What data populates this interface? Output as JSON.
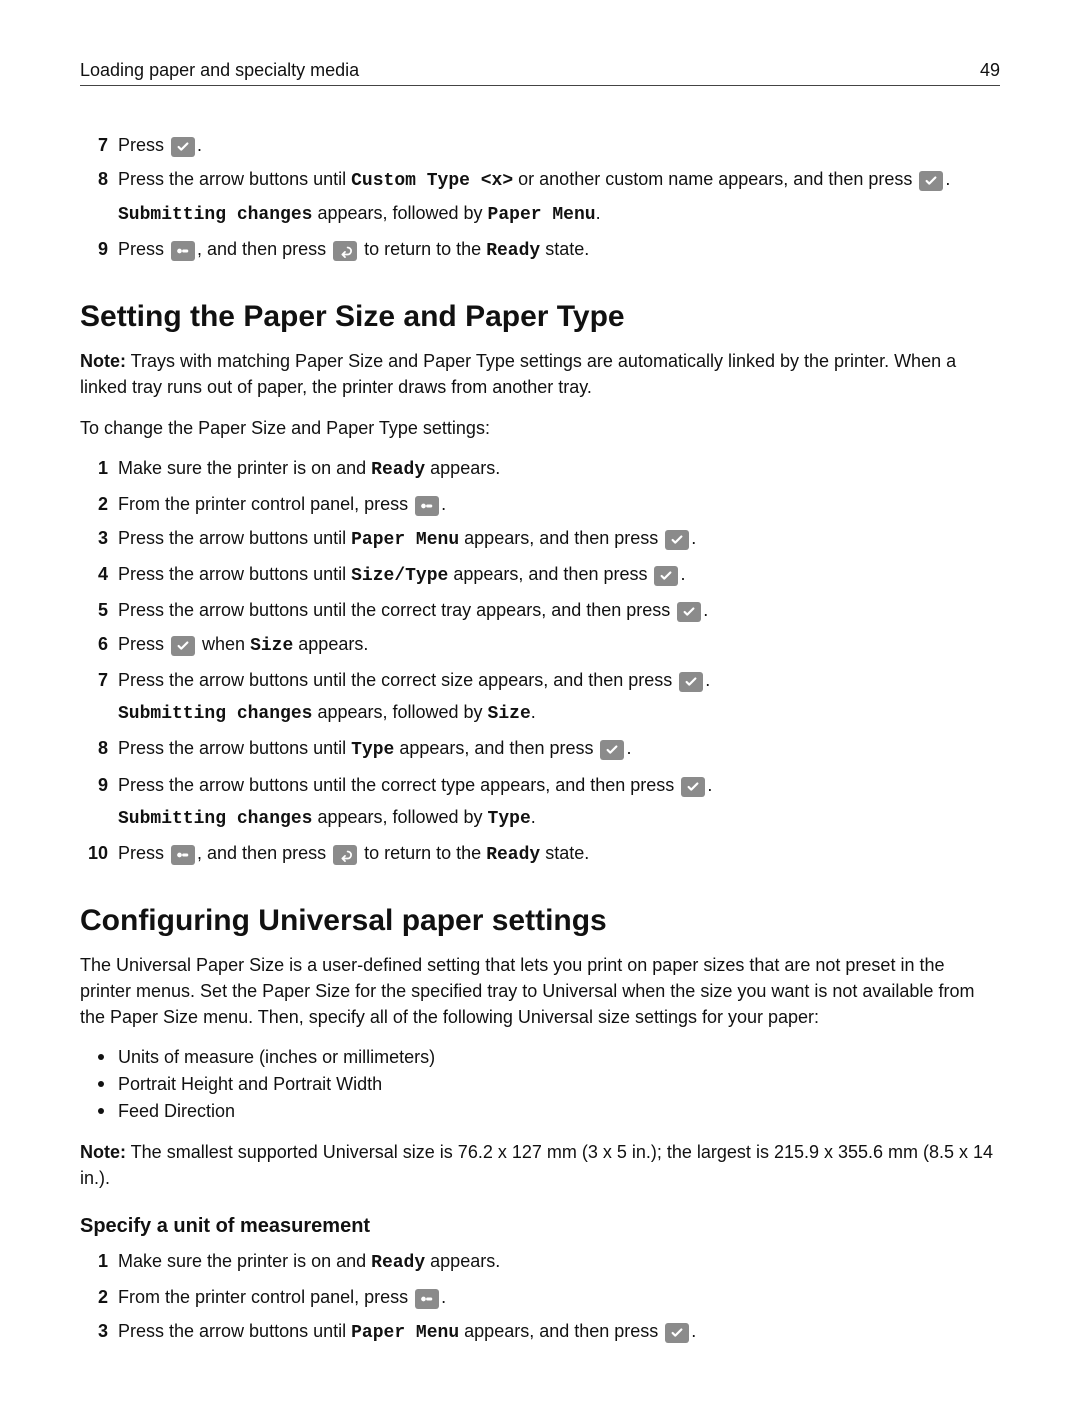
{
  "header": {
    "title": "Loading paper and specialty media",
    "page_number": "49"
  },
  "top_steps": [
    {
      "n": "7",
      "parts": [
        {
          "t": "Press "
        },
        {
          "icon": "check"
        },
        {
          "t": "."
        }
      ]
    },
    {
      "n": "8",
      "parts": [
        {
          "t": "Press the arrow buttons until "
        },
        {
          "mono": "Custom Type <x>"
        },
        {
          "t": " or another custom name appears, and then press "
        },
        {
          "icon": "check"
        },
        {
          "t": "."
        }
      ],
      "sub": [
        {
          "mono": "Submitting changes"
        },
        {
          "t": " appears, followed by "
        },
        {
          "mono": "Paper Menu"
        },
        {
          "t": "."
        }
      ]
    },
    {
      "n": "9",
      "parts": [
        {
          "t": "Press "
        },
        {
          "icon": "menu"
        },
        {
          "t": ", and then press "
        },
        {
          "icon": "back"
        },
        {
          "t": " to return to the "
        },
        {
          "mono": "Ready"
        },
        {
          "t": " state."
        }
      ]
    }
  ],
  "section1": {
    "heading": "Setting the Paper Size and Paper Type",
    "note_label": "Note:",
    "note": " Trays with matching Paper Size and Paper Type settings are automatically linked by the printer. When a linked tray runs out of paper, the printer draws from another tray.",
    "lead": "To change the Paper Size and Paper Type settings:",
    "steps": [
      {
        "n": "1",
        "parts": [
          {
            "t": "Make sure the printer is on and "
          },
          {
            "mono": "Ready"
          },
          {
            "t": " appears."
          }
        ]
      },
      {
        "n": "2",
        "parts": [
          {
            "t": "From the printer control panel, press "
          },
          {
            "icon": "menu"
          },
          {
            "t": "."
          }
        ]
      },
      {
        "n": "3",
        "parts": [
          {
            "t": "Press the arrow buttons until "
          },
          {
            "mono": "Paper Menu"
          },
          {
            "t": " appears, and then press "
          },
          {
            "icon": "check"
          },
          {
            "t": "."
          }
        ]
      },
      {
        "n": "4",
        "parts": [
          {
            "t": "Press the arrow buttons until "
          },
          {
            "mono": "Size/Type"
          },
          {
            "t": " appears, and then press "
          },
          {
            "icon": "check"
          },
          {
            "t": "."
          }
        ]
      },
      {
        "n": "5",
        "parts": [
          {
            "t": "Press the arrow buttons until the correct tray appears, and then press "
          },
          {
            "icon": "check"
          },
          {
            "t": "."
          }
        ]
      },
      {
        "n": "6",
        "parts": [
          {
            "t": "Press "
          },
          {
            "icon": "check"
          },
          {
            "t": " when "
          },
          {
            "mono": "Size"
          },
          {
            "t": " appears."
          }
        ]
      },
      {
        "n": "7",
        "parts": [
          {
            "t": "Press the arrow buttons until the correct size appears, and then press "
          },
          {
            "icon": "check"
          },
          {
            "t": "."
          }
        ],
        "sub": [
          {
            "mono": "Submitting changes"
          },
          {
            "t": " appears, followed by "
          },
          {
            "mono": "Size"
          },
          {
            "t": "."
          }
        ]
      },
      {
        "n": "8",
        "parts": [
          {
            "t": "Press the arrow buttons until "
          },
          {
            "mono": "Type"
          },
          {
            "t": " appears, and then press "
          },
          {
            "icon": "check"
          },
          {
            "t": "."
          }
        ]
      },
      {
        "n": "9",
        "parts": [
          {
            "t": "Press the arrow buttons until the correct type appears, and then press "
          },
          {
            "icon": "check"
          },
          {
            "t": "."
          }
        ],
        "sub": [
          {
            "mono": "Submitting changes"
          },
          {
            "t": " appears, followed by "
          },
          {
            "mono": "Type"
          },
          {
            "t": "."
          }
        ]
      },
      {
        "n": "10",
        "parts": [
          {
            "t": "Press "
          },
          {
            "icon": "menu"
          },
          {
            "t": ", and then press "
          },
          {
            "icon": "back"
          },
          {
            "t": " to return to the "
          },
          {
            "mono": "Ready"
          },
          {
            "t": " state."
          }
        ]
      }
    ]
  },
  "section2": {
    "heading": "Configuring Universal paper settings",
    "para": "The Universal Paper Size is a user‑defined setting that lets you print on paper sizes that are not preset in the printer menus. Set the Paper Size for the specified tray to Universal when the size you want is not available from the Paper Size menu. Then, specify all of the following Universal size settings for your paper:",
    "bullets": [
      "Units of measure (inches or millimeters)",
      "Portrait Height and Portrait Width",
      "Feed Direction"
    ],
    "note_label": "Note:",
    "note": " The smallest supported Universal size is 76.2 x 127 mm (3  x 5 in.); the largest is 215.9 x 355.6 mm (8.5 x 14 in.).",
    "sub_heading": "Specify a unit of measurement",
    "steps": [
      {
        "n": "1",
        "parts": [
          {
            "t": "Make sure the printer is on and "
          },
          {
            "mono": "Ready"
          },
          {
            "t": " appears."
          }
        ]
      },
      {
        "n": "2",
        "parts": [
          {
            "t": "From the printer control panel, press "
          },
          {
            "icon": "menu"
          },
          {
            "t": "."
          }
        ]
      },
      {
        "n": "3",
        "parts": [
          {
            "t": "Press the arrow buttons until "
          },
          {
            "mono": "Paper Menu"
          },
          {
            "t": " appears, and then press "
          },
          {
            "icon": "check"
          },
          {
            "t": "."
          }
        ]
      }
    ]
  },
  "icons": {
    "check": "check-icon",
    "menu": "menu-icon",
    "back": "back-icon"
  }
}
